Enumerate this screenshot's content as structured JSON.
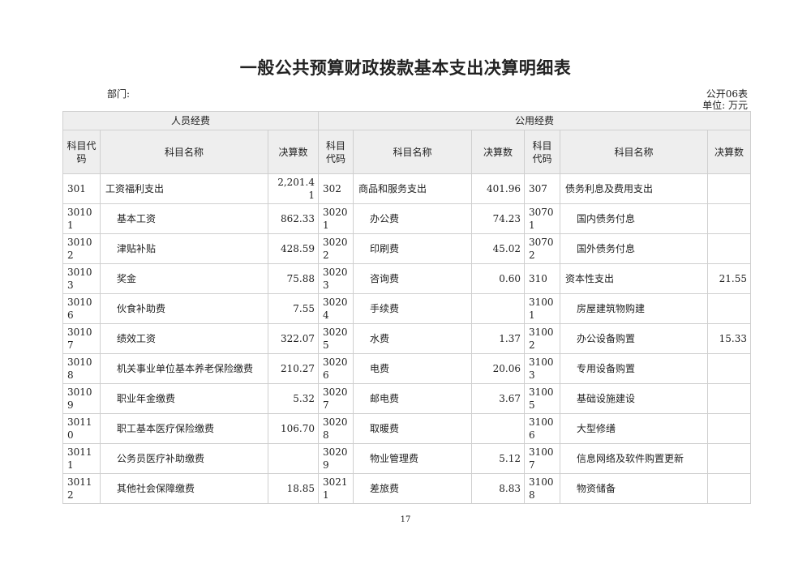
{
  "title": "一般公共预算财政拨款基本支出决算明细表",
  "dept_label": "部门:",
  "table_no": "公开06表",
  "unit_label": "单位: 万元",
  "groups": {
    "personnel": "人员经费",
    "public": "公用经费"
  },
  "headers": {
    "code": "科目代码",
    "name": "科目名称",
    "amount": "决算数"
  },
  "rows": [
    [
      "301",
      "工资福利支出",
      "2,201.41",
      "302",
      "商品和服务支出",
      "401.96",
      "307",
      "债务利息及费用支出",
      ""
    ],
    [
      "30101",
      "基本工资",
      "862.33",
      "30201",
      "办公费",
      "74.23",
      "30701",
      "国内债务付息",
      ""
    ],
    [
      "30102",
      "津贴补贴",
      "428.59",
      "30202",
      "印刷费",
      "45.02",
      "30702",
      "国外债务付息",
      ""
    ],
    [
      "30103",
      "奖金",
      "75.88",
      "30203",
      "咨询费",
      "0.60",
      "310",
      "资本性支出",
      "21.55"
    ],
    [
      "30106",
      "伙食补助费",
      "7.55",
      "30204",
      "手续费",
      "",
      "31001",
      "房屋建筑物购建",
      ""
    ],
    [
      "30107",
      "绩效工资",
      "322.07",
      "30205",
      "水费",
      "1.37",
      "31002",
      "办公设备购置",
      "15.33"
    ],
    [
      "30108",
      "机关事业单位基本养老保险缴费",
      "210.27",
      "30206",
      "电费",
      "20.06",
      "31003",
      "专用设备购置",
      ""
    ],
    [
      "30109",
      "职业年金缴费",
      "5.32",
      "30207",
      "邮电费",
      "3.67",
      "31005",
      "基础设施建设",
      ""
    ],
    [
      "30110",
      "职工基本医疗保险缴费",
      "106.70",
      "30208",
      "取暖费",
      "",
      "31006",
      "大型修缮",
      ""
    ],
    [
      "30111",
      "公务员医疗补助缴费",
      "",
      "30209",
      "物业管理费",
      "5.12",
      "31007",
      "信息网络及软件购置更新",
      ""
    ],
    [
      "30112",
      "其他社会保障缴费",
      "18.85",
      "30211",
      "差旅费",
      "8.83",
      "31008",
      "物资储备",
      ""
    ]
  ],
  "page_number": "17"
}
